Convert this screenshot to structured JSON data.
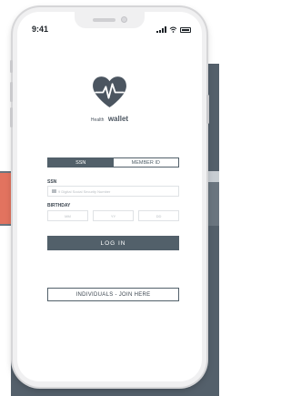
{
  "status": {
    "time": "9:41"
  },
  "brand": {
    "prefix": "Health",
    "name": "wallet"
  },
  "tabs": {
    "ssn": "SSN",
    "member_id": "MEMBER ID"
  },
  "form": {
    "ssn_label": "SSN",
    "ssn_placeholder": "9 Digital Social Security Number",
    "birthday_label": "BIRTHDAY",
    "month_placeholder": "MM",
    "year_placeholder": "YY",
    "day_placeholder": "DD"
  },
  "buttons": {
    "login": "LOG IN",
    "join": "INDIVIDUALS - JOIN HERE"
  },
  "colors": {
    "primary": "#52606a",
    "accent": "#e2735f",
    "backdrop": "#54606b"
  }
}
